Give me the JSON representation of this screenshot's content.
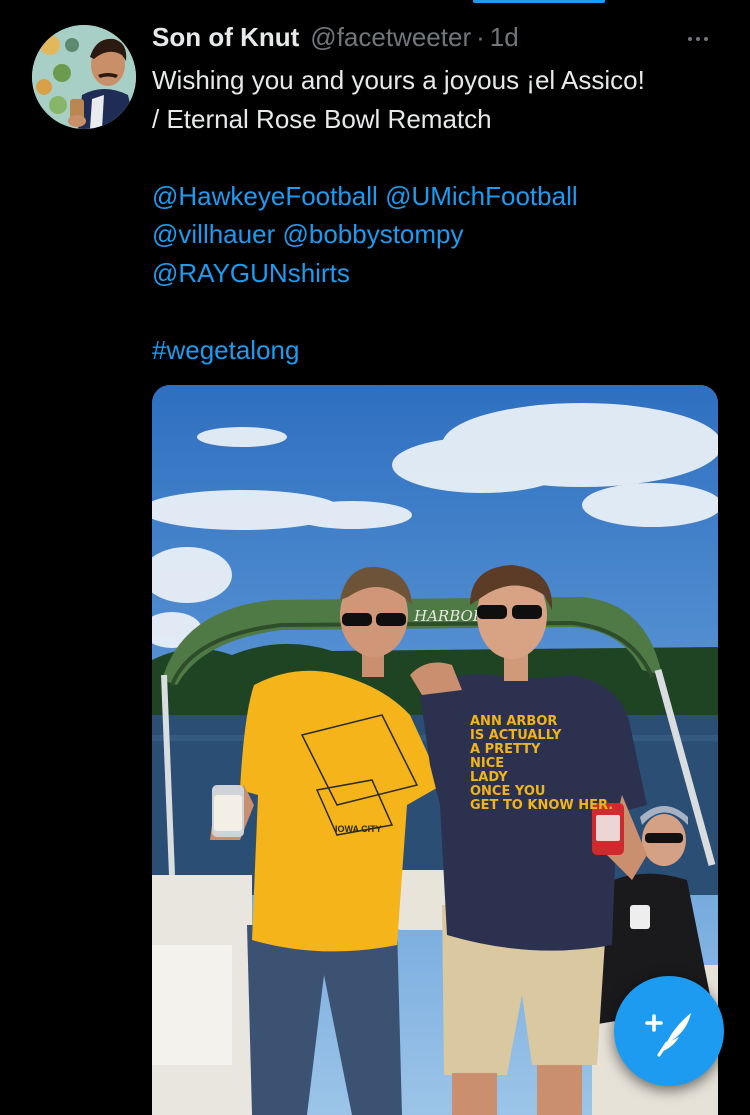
{
  "tweet": {
    "display_name": "Son of Knut",
    "handle": "@facetweeter",
    "separator": "·",
    "time": "1d",
    "text_line1": "Wishing you and yours a joyous ¡el Assico!",
    "text_line2": "/ Eternal Rose Bowl Rematch",
    "mentions": [
      "@HawkeyeFootball",
      "@UMichFootball",
      "@villhauer",
      "@bobbystompy",
      "@RAYGUNshirts"
    ],
    "hashtag": "#wegetalong"
  },
  "photo": {
    "canopy_text": "HARBOR",
    "shirt_left_text": "IOWA CITY",
    "shirt_right_lines": [
      "ANN ARBOR",
      "IS ACTUALLY",
      "A PRETTY",
      "NICE",
      "LADY",
      "ONCE YOU",
      "GET TO KNOW HER."
    ]
  },
  "icons": {
    "more": "more-horizontal-icon",
    "compose": "compose-tweet-icon"
  },
  "colors": {
    "accent": "#1d9bf0",
    "background": "#000000",
    "secondary_text": "#71767b",
    "primary_text": "#e7e9ea"
  }
}
